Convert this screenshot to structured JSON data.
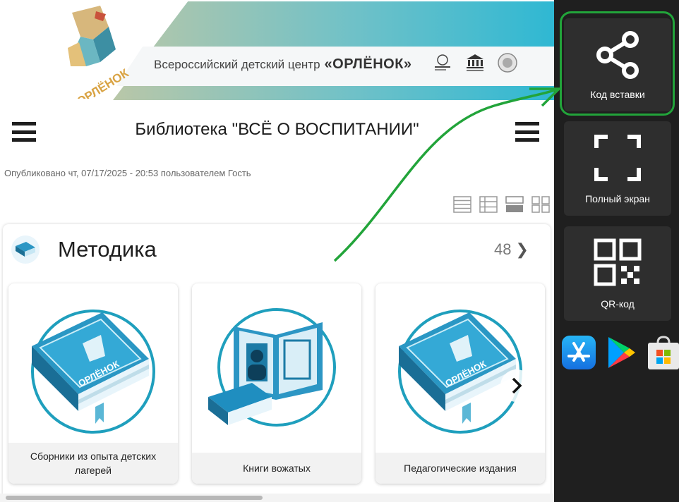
{
  "banner": {
    "org_prefix": "Всероссийский детский центр",
    "org_name": "«ОРЛЁНОК»",
    "logo_text": "ОРЛЁНОК"
  },
  "header": {
    "title": "Библиотека \"ВСЁ О ВОСПИТАНИИ\""
  },
  "meta": {
    "published": "Опубликовано чт, 07/17/2025 - 20:53 пользователем Гость"
  },
  "view_modes": [
    "list-view-icon",
    "table-view-icon",
    "cards-view-icon",
    "grid-view-icon"
  ],
  "section": {
    "title": "Методика",
    "count": "48",
    "cards": [
      {
        "caption": "Сборники из опыта детских лагерей",
        "icon": "book-icon"
      },
      {
        "caption": "Книги вожатых",
        "icon": "open-book-icon"
      },
      {
        "caption": "Педагогические издания",
        "icon": "book-icon"
      }
    ]
  },
  "sidebar": {
    "embed_label": "Код вставки",
    "fullscreen_label": "Полный экран",
    "qr_label": "QR-код",
    "stores": [
      "app-store-icon",
      "google-play-icon",
      "microsoft-store-icon"
    ]
  },
  "colors": {
    "sidebar_bg": "#1f1f1f",
    "side_button_bg": "#2e2e2e",
    "highlight_green": "#22a43a",
    "book_blue": "#1e88b5",
    "banner_teal": "#2fb8d3"
  }
}
